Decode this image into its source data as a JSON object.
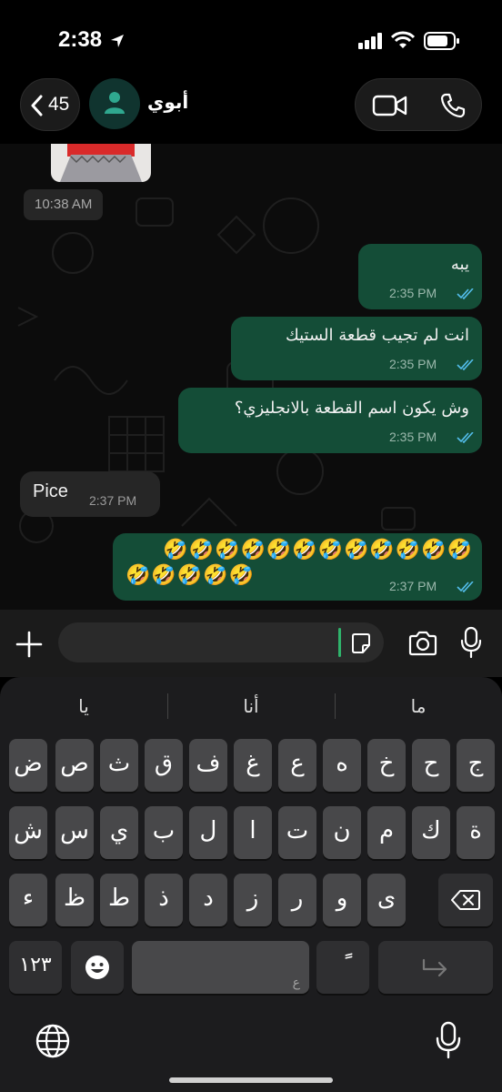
{
  "status": {
    "time": "2:38"
  },
  "header": {
    "back_count": "45",
    "contact_name": "أبوي"
  },
  "chat": {
    "day_chip": "10:38 AM",
    "messages": [
      {
        "dir": "out",
        "text": "يبه",
        "time": "2:35 PM"
      },
      {
        "dir": "out",
        "text": "انت لم تجيب قطعة الستيك",
        "time": "2:35 PM"
      },
      {
        "dir": "out",
        "text": "وش يكون اسم القطعة بالانجليزي؟",
        "time": "2:35 PM"
      },
      {
        "dir": "in",
        "text": "Pice",
        "time": "2:37 PM"
      },
      {
        "dir": "out",
        "text_line1": "🤣🤣🤣🤣🤣🤣🤣🤣🤣🤣🤣🤣",
        "text_line2": "🤣🤣🤣🤣🤣",
        "time": "2:37 PM"
      }
    ]
  },
  "keyboard": {
    "suggestions": [
      "ما",
      "أنا",
      "يا"
    ],
    "row1": [
      "ج",
      "ح",
      "خ",
      "ه",
      "ع",
      "غ",
      "ف",
      "ق",
      "ث",
      "ص",
      "ض"
    ],
    "row2": [
      "ة",
      "ك",
      "م",
      "ن",
      "ت",
      "ا",
      "ل",
      "ب",
      "ي",
      "س",
      "ش"
    ],
    "row3": [
      "ى",
      "و",
      "ر",
      "ز",
      "د",
      "ذ",
      "ط",
      "ظ",
      "ء"
    ],
    "numbers_key": "١٢٣",
    "diacritic_key": "ًً",
    "space_hint": "ع"
  },
  "colors": {
    "outgoing_bubble": "#144d37",
    "incoming_bubble": "#262626",
    "accent_green": "#2fb36b",
    "read_ticks": "#53bdeb"
  }
}
